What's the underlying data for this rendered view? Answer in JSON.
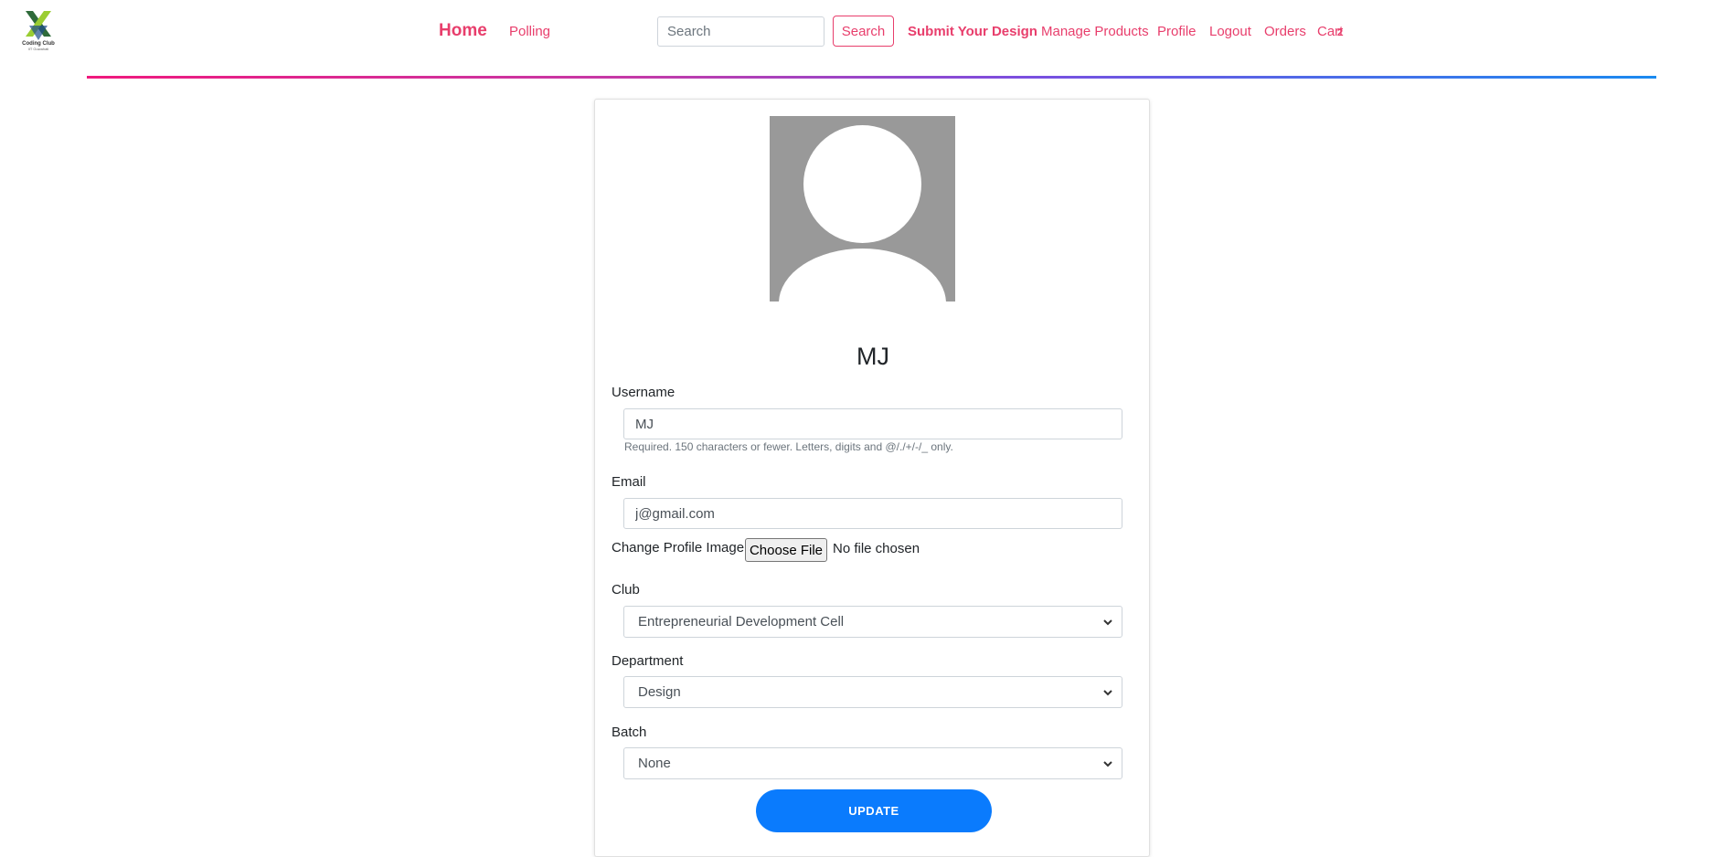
{
  "nav": {
    "logo_text": "Coding Club",
    "logo_sub": "IIT Guwahati",
    "home": "Home",
    "polling": "Polling",
    "search_placeholder": "Search",
    "search_button": "Search",
    "submit_design": "Submit Your Design",
    "manage_products": "Manage Products",
    "profile": "Profile",
    "logout": "Logout",
    "orders": "Orders",
    "cart": "Cart",
    "cart_count": "2"
  },
  "colors": {
    "accent": "#e83e6c",
    "primary_button": "#0a7bfd",
    "avatar_bg": "#999999"
  },
  "profile": {
    "name": "MJ",
    "avatar_icon": "default-user-avatar"
  },
  "form": {
    "username_label": "Username",
    "username_value": "MJ",
    "username_help": "Required. 150 characters or fewer. Letters, digits and @/./+/-/_ only.",
    "email_label": "Email",
    "email_value": "j@gmail.com",
    "image_label": "Change Profile Image:",
    "file_button": "Choose File",
    "file_status": "No file chosen",
    "club_label": "Club",
    "club_value": "Entrepreneurial Development Cell",
    "department_label": "Department",
    "department_value": "Design",
    "batch_label": "Batch",
    "batch_value": "None",
    "update_button": "UPDATE"
  }
}
